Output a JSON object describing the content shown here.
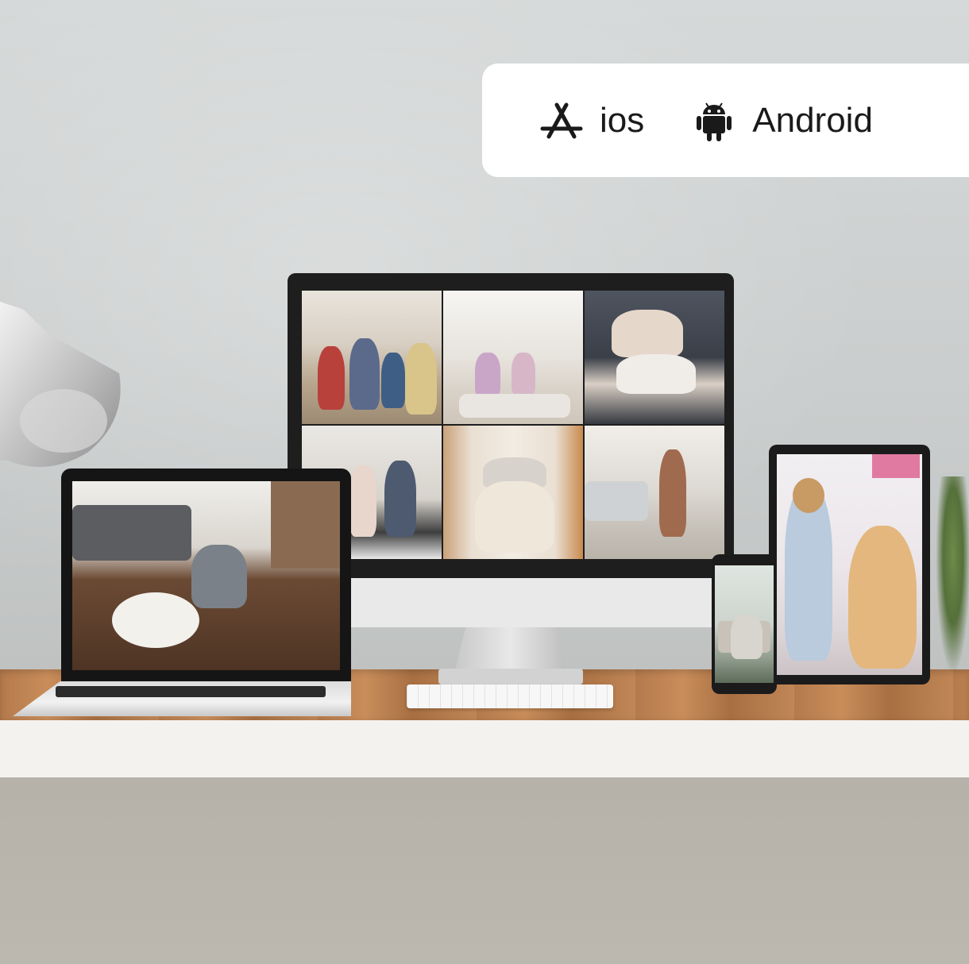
{
  "badge": {
    "ios_label": "ios",
    "android_label": "Android",
    "ios_icon": "app-store-icon",
    "android_icon": "android-robot-icon"
  },
  "colors": {
    "badge_bg": "#ffffff",
    "badge_text": "#1a1a1a",
    "wall": "#cfd2d2",
    "desk_wood": "#b57a4c"
  }
}
